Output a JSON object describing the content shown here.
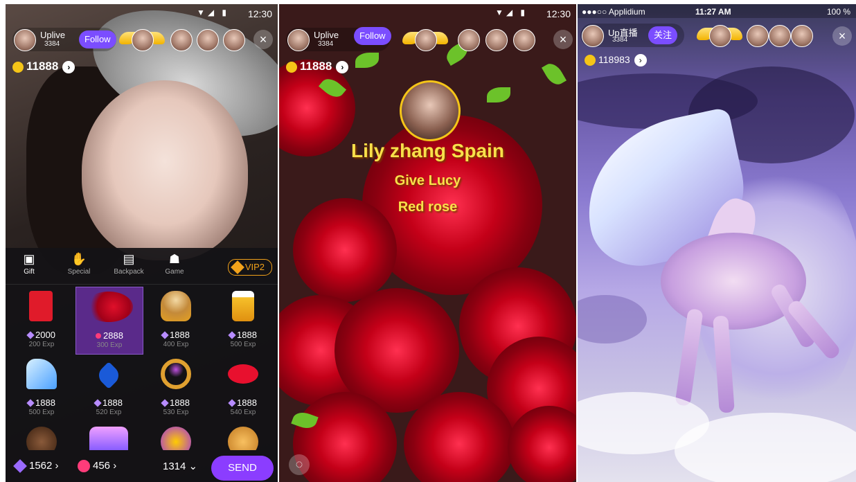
{
  "panel1": {
    "statusbar": {
      "time": "12:30"
    },
    "host": {
      "name": "Uplive",
      "count": "3384",
      "follow_label": "Follow"
    },
    "close_glyph": "×",
    "coins": {
      "value": "11888",
      "arrow": "›"
    },
    "tabs": [
      {
        "label": "Gift",
        "icon": "gift-box-icon"
      },
      {
        "label": "Special",
        "icon": "special-icon"
      },
      {
        "label": "Backpack",
        "icon": "backpack-icon"
      },
      {
        "label": "Game",
        "icon": "gamepad-icon"
      }
    ],
    "vip_label": "VIP2",
    "gifts": [
      {
        "price": "2000",
        "exp": "200 Exp",
        "icon": "red-envelope-icon"
      },
      {
        "price": "2888",
        "exp": "300 Exp",
        "icon": "rose-bouquet-icon",
        "selected": true
      },
      {
        "price": "1888",
        "exp": "400 Exp",
        "icon": "cappuccino-icon"
      },
      {
        "price": "1888",
        "exp": "500 Exp",
        "icon": "beer-mug-icon"
      },
      {
        "price": "1888",
        "exp": "500 Exp",
        "icon": "glass-slipper-icon"
      },
      {
        "price": "1888",
        "exp": "520 Exp",
        "icon": "heart-necklace-icon"
      },
      {
        "price": "1888",
        "exp": "530 Exp",
        "icon": "ring-icon"
      },
      {
        "price": "1888",
        "exp": "540 Exp",
        "icon": "lips-icon"
      }
    ],
    "bottom": {
      "diamonds": "1562",
      "rubies": "456",
      "quantity": "1314",
      "send_label": "SEND"
    }
  },
  "panel2": {
    "statusbar": {
      "time": "12:30"
    },
    "host": {
      "name": "Uplive",
      "count": "3384",
      "follow_label": "Follow"
    },
    "close_glyph": "×",
    "coins": {
      "value": "11888",
      "arrow": "›"
    },
    "message": {
      "sender": "Lily zhang Spain",
      "line2": "Give Lucy",
      "line3": "Red rose"
    }
  },
  "panel3": {
    "statusbar": {
      "carrier": "●●●○○ Applidium",
      "time": "11:27 AM",
      "battery": "100 %"
    },
    "host": {
      "name": "Up直播",
      "count": "3384",
      "follow_label": "关注"
    },
    "close_glyph": "×",
    "coins": {
      "value": "118983",
      "arrow": "›"
    }
  },
  "colors": {
    "accent": "#7b4dff",
    "send": "#8b3dff",
    "vip": "#f2a21a",
    "gold_text": "#f8e04a",
    "coin": "#f5c518"
  }
}
